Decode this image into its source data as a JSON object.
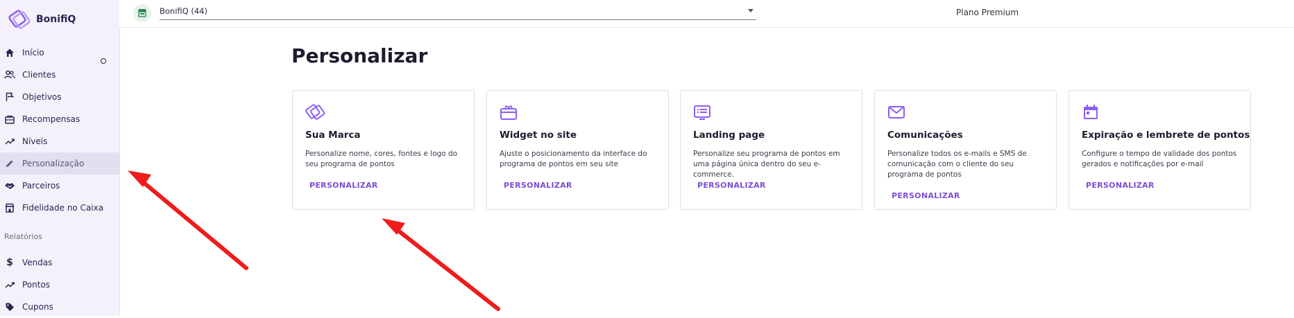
{
  "app": {
    "logo_text": "BonifiQ"
  },
  "sidebar": {
    "items": [
      {
        "label": "Início",
        "icon": "home-icon"
      },
      {
        "label": "Clientes",
        "icon": "users-icon"
      },
      {
        "label": "Objetivos",
        "icon": "flag-icon"
      },
      {
        "label": "Recompensas",
        "icon": "gift-icon"
      },
      {
        "label": "Níveis",
        "icon": "trending-up-icon"
      },
      {
        "label": "Personalização",
        "icon": "pencil-icon",
        "active": true
      },
      {
        "label": "Parceiros",
        "icon": "handshake-icon"
      },
      {
        "label": "Fidelidade no Caixa",
        "icon": "store-icon"
      }
    ],
    "reports_label": "Relatórios",
    "report_items": [
      {
        "label": "Vendas",
        "icon": "dollar-icon"
      },
      {
        "label": "Pontos",
        "icon": "trending-up-icon"
      },
      {
        "label": "Cupons",
        "icon": "tag-icon"
      }
    ]
  },
  "topbar": {
    "store_select_value": "BonifiQ (44)",
    "plan_label": "Plano Premium"
  },
  "main": {
    "title": "Personalizar",
    "cards": [
      {
        "icon": "brand-tag-icon",
        "title": "Sua Marca",
        "description": "Personalize nome, cores, fontes e logo do seu programa de pontos",
        "action": "PERSONALIZAR"
      },
      {
        "icon": "widget-icon",
        "title": "Widget no site",
        "description": "Ajuste o posicionamento da interface do programa de pontos em seu site",
        "action": "PERSONALIZAR"
      },
      {
        "icon": "landing-page-icon",
        "title": "Landing page",
        "description": "Personalize seu programa de pontos em uma página única dentro do seu e-commerce.",
        "action": "PERSONALIZAR"
      },
      {
        "icon": "mail-icon",
        "title": "Comunicações",
        "description": "Personalize todos os e-mails e SMS de comunicação com o cliente do seu programa de pontos",
        "action": "PERSONALIZAR"
      },
      {
        "icon": "calendar-icon",
        "title": "Expiração e lembrete de pontos",
        "description": "Configure o tempo de validade dos pontos gerados e notificações por e-mail",
        "action": "PERSONALIZAR"
      }
    ]
  },
  "colors": {
    "accent": "#7c4dd6",
    "annotation_arrow": "#ee1c1c",
    "sidebar_bg": "#f4f1fb"
  }
}
